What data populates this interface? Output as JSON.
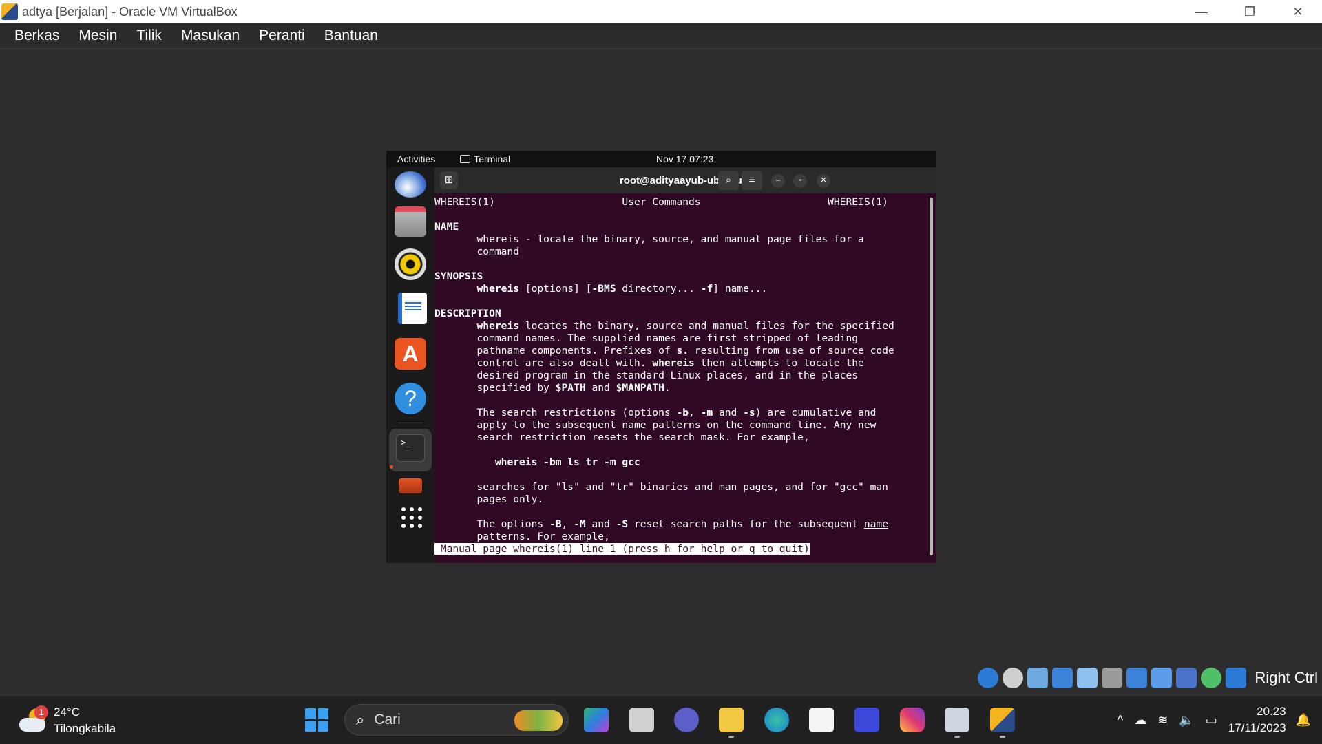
{
  "window": {
    "title": "adtya [Berjalan] - Oracle VM VirtualBox",
    "controls": {
      "minimize": "—",
      "restore": "❐",
      "close": "✕"
    }
  },
  "menu": [
    "Berkas",
    "Mesin",
    "Tilik",
    "Masukan",
    "Peranti",
    "Bantuan"
  ],
  "gnome": {
    "activities": "Activities",
    "app": "Terminal",
    "clock": "Nov 17  07:23",
    "tray_icons": [
      "network-icon",
      "volume-icon",
      "battery-icon"
    ]
  },
  "terminal": {
    "title": "root@adityaayub-ubuntu: /",
    "buttons": {
      "new_tab": "⊞",
      "search": "⌕",
      "menu": "≡",
      "minimize": "–",
      "maximize": "▫",
      "close": "✕"
    },
    "lines": [
      [
        {
          "t": "WHEREIS(1)                     User Commands                     WHEREIS(1)"
        }
      ],
      [
        {
          "t": ""
        }
      ],
      [
        {
          "t": "NAME",
          "b": true
        }
      ],
      [
        {
          "t": "       whereis - locate the binary, source, and manual page files for a"
        }
      ],
      [
        {
          "t": "       command"
        }
      ],
      [
        {
          "t": ""
        }
      ],
      [
        {
          "t": "SYNOPSIS",
          "b": true
        }
      ],
      [
        {
          "t": "       "
        },
        {
          "t": "whereis",
          "b": true
        },
        {
          "t": " [options] ["
        },
        {
          "t": "-BMS",
          "b": true
        },
        {
          "t": " "
        },
        {
          "t": "directory",
          "u": true
        },
        {
          "t": "... "
        },
        {
          "t": "-f",
          "b": true
        },
        {
          "t": "] "
        },
        {
          "t": "name",
          "u": true
        },
        {
          "t": "..."
        }
      ],
      [
        {
          "t": ""
        }
      ],
      [
        {
          "t": "DESCRIPTION",
          "b": true
        }
      ],
      [
        {
          "t": "       "
        },
        {
          "t": "whereis",
          "b": true
        },
        {
          "t": " locates the binary, source and manual files for the specified"
        }
      ],
      [
        {
          "t": "       command names. The supplied names are first stripped of leading"
        }
      ],
      [
        {
          "t": "       pathname components. Prefixes of "
        },
        {
          "t": "s.",
          "b": true
        },
        {
          "t": " resulting from use of source code"
        }
      ],
      [
        {
          "t": "       control are also dealt with. "
        },
        {
          "t": "whereis",
          "b": true
        },
        {
          "t": " then attempts to locate the"
        }
      ],
      [
        {
          "t": "       desired program in the standard Linux places, and in the places"
        }
      ],
      [
        {
          "t": "       specified by "
        },
        {
          "t": "$PATH",
          "b": true
        },
        {
          "t": " and "
        },
        {
          "t": "$MANPATH",
          "b": true
        },
        {
          "t": "."
        }
      ],
      [
        {
          "t": ""
        }
      ],
      [
        {
          "t": "       The search restrictions (options "
        },
        {
          "t": "-b",
          "b": true
        },
        {
          "t": ", "
        },
        {
          "t": "-m",
          "b": true
        },
        {
          "t": " and "
        },
        {
          "t": "-s",
          "b": true
        },
        {
          "t": ") are cumulative and"
        }
      ],
      [
        {
          "t": "       apply to the subsequent "
        },
        {
          "t": "name",
          "u": true
        },
        {
          "t": " patterns on the command line. Any new"
        }
      ],
      [
        {
          "t": "       search restriction resets the search mask. For example,"
        }
      ],
      [
        {
          "t": ""
        }
      ],
      [
        {
          "t": "          "
        },
        {
          "t": "whereis -bm ls tr -m gcc",
          "b": true
        }
      ],
      [
        {
          "t": ""
        }
      ],
      [
        {
          "t": "       searches for \"ls\" and \"tr\" binaries and man pages, and for \"gcc\" man"
        }
      ],
      [
        {
          "t": "       pages only."
        }
      ],
      [
        {
          "t": ""
        }
      ],
      [
        {
          "t": "       The options "
        },
        {
          "t": "-B",
          "b": true
        },
        {
          "t": ", "
        },
        {
          "t": "-M",
          "b": true
        },
        {
          "t": " and "
        },
        {
          "t": "-S",
          "b": true
        },
        {
          "t": " reset search paths for the subsequent "
        },
        {
          "t": "name",
          "u": true
        }
      ],
      [
        {
          "t": "       patterns. For example,"
        }
      ]
    ],
    "status_line": " Manual page whereis(1) line 1 (press h for help or q to quit)"
  },
  "dock_apps": [
    "thunderbird-icon",
    "files-icon",
    "rhythmbox-icon",
    "libreoffice-writer-icon",
    "app-center-icon",
    "help-icon",
    "terminal-icon",
    "app-grid-icon"
  ],
  "dock_glyphs": {
    "store": "A",
    "help": "?",
    "terminal": ">_"
  },
  "host_status": {
    "label": "Right Ctrl"
  },
  "taskbar": {
    "weather": {
      "temp": "24°C",
      "location": "Tilongkabila",
      "badge": "1"
    },
    "search_placeholder": "Cari",
    "search_glyph": "⌕",
    "time": "20.23",
    "date": "17/11/2023",
    "tray_glyphs": {
      "chevron": "^",
      "cloud": "☁",
      "wifi": "≋",
      "volume": "🔈",
      "battery": "▭",
      "bell": "🔔"
    }
  }
}
